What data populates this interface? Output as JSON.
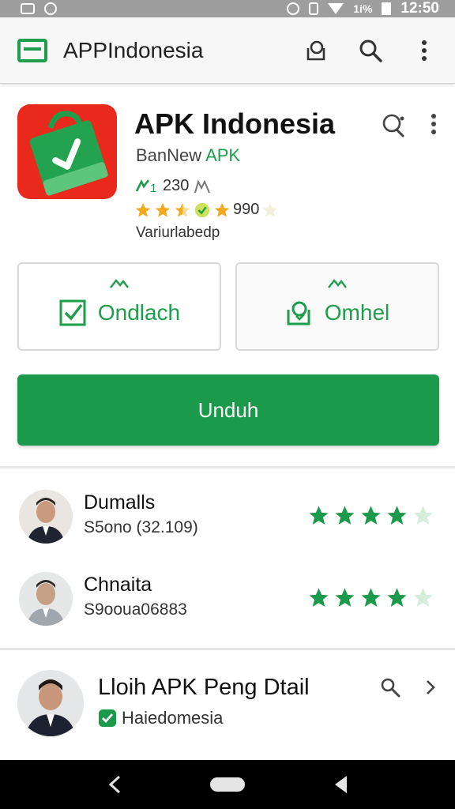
{
  "status_bar": {
    "time": "12:50",
    "signal_label": "1i%"
  },
  "toolbar": {
    "title": "APPIndonesia"
  },
  "app": {
    "name": "APK Indonesia",
    "developer_prefix": "BanNew",
    "developer_suffix": "APK",
    "meta_count": "230",
    "rating_count": "990",
    "sub_text": "Variurlabedp",
    "rating_stars": 3.5
  },
  "actions": {
    "left_label": "Ondlach",
    "right_label": "Omhel",
    "install_label": "Unduh"
  },
  "reviews": [
    {
      "name": "Dumalls",
      "sub": "S5ono (32.109)",
      "stars": 4.5
    },
    {
      "name": "Chnaita",
      "sub": "S9ooua06883",
      "stars": 4.5
    }
  ],
  "card": {
    "title": "Lloih APK Peng Dtail",
    "sub": "Haiedomesia"
  },
  "colors": {
    "accent": "#1c9a4b",
    "logo_red": "#e8291c",
    "star_gold": "#f2a91b"
  },
  "icons": [
    "app-logo-icon",
    "chat-icon",
    "search-icon",
    "more-icon",
    "check-box-icon",
    "download-icon",
    "verified-icon",
    "chevron-right-icon",
    "back-icon",
    "home-icon",
    "recents-icon"
  ]
}
